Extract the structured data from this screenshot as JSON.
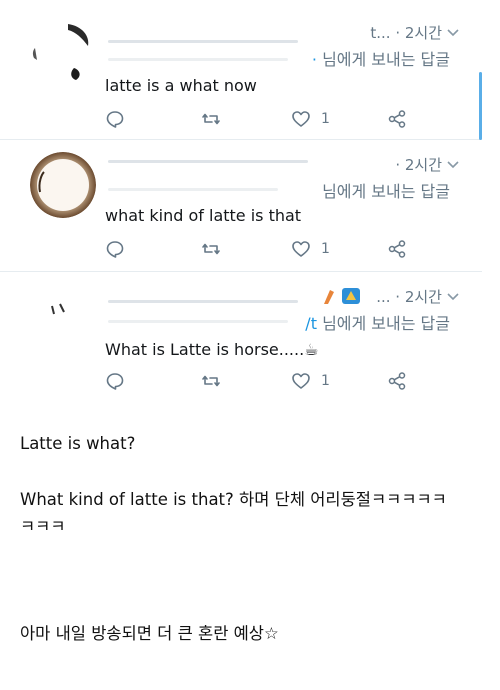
{
  "tweets": [
    {
      "meta": "t... · 2시간",
      "reply_handle": "·",
      "reply_suffix": "님에게 보내는 답글",
      "text": "latte is a what now",
      "like_count": "1"
    },
    {
      "meta": "· 2시간",
      "reply_handle": "",
      "reply_suffix": "님에게 보내는 답글",
      "text": "what kind of latte is that",
      "like_count": "1"
    },
    {
      "meta": "... · 2시간",
      "reply_handle": "/t",
      "reply_suffix": "님에게 보내는 답글",
      "text": "What is Latte is horse.....☕",
      "like_count": "1"
    }
  ],
  "caption": {
    "line1": "Latte is what?",
    "line2": "What kind of latte is that? 하며 단체 어리둥절ㅋㅋㅋㅋㅋ",
    "line3": "ㅋㅋㅋ",
    "line4": "아마 내일 방송되면 더 큰 혼란 예상☆"
  },
  "colors": {
    "accent": "#1b95e0",
    "muted": "#657786",
    "scrollbar": "#5aaee8"
  },
  "icons": [
    "reply-icon",
    "retweet-icon",
    "like-icon",
    "share-icon",
    "chevron-down-icon"
  ]
}
